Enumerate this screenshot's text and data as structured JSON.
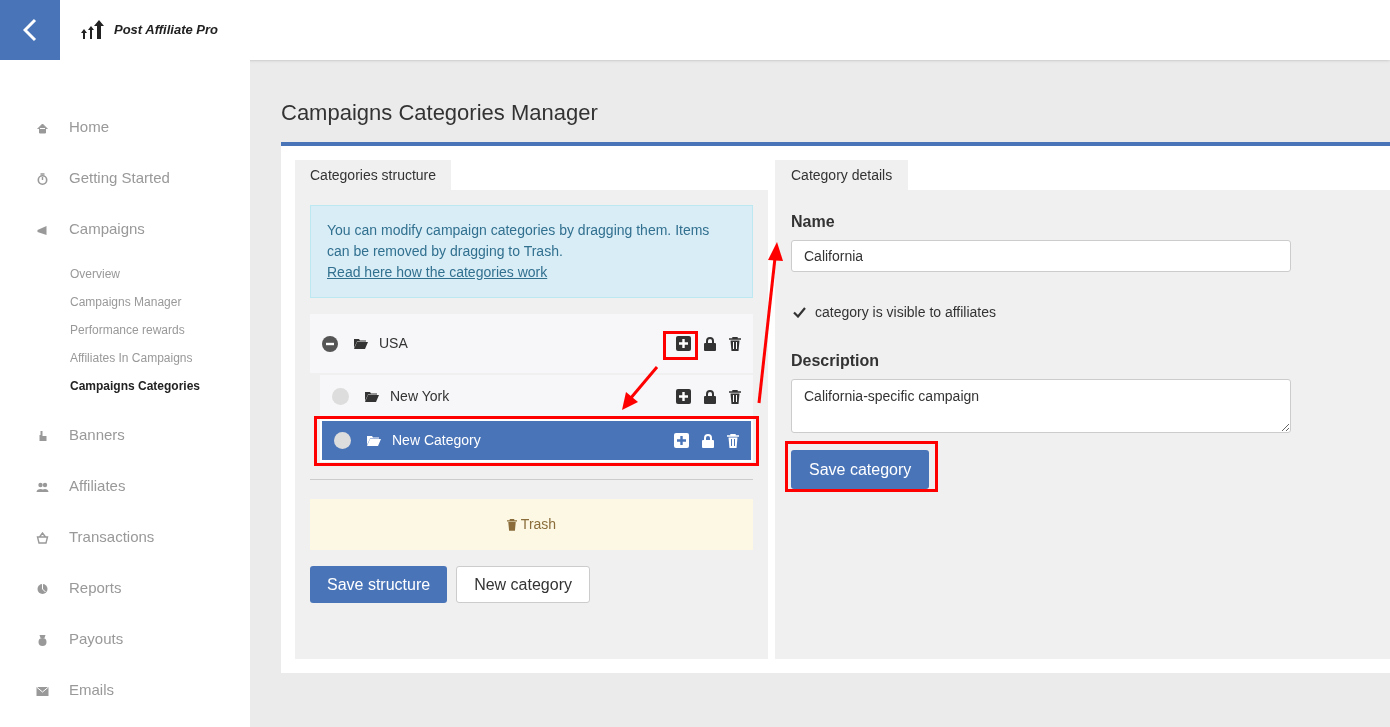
{
  "header": {
    "logo_text": "Post Affiliate Pro"
  },
  "sidebar": {
    "items": [
      {
        "label": "Home",
        "selected": false
      },
      {
        "label": "Getting Started",
        "selected": false
      },
      {
        "label": "Campaigns",
        "selected": false,
        "children": [
          {
            "label": "Overview",
            "selected": false
          },
          {
            "label": "Campaigns Manager",
            "selected": false
          },
          {
            "label": "Performance rewards",
            "selected": false
          },
          {
            "label": "Affiliates In Campaigns",
            "selected": false
          },
          {
            "label": "Campaigns Categories",
            "selected": true
          }
        ]
      },
      {
        "label": "Banners",
        "selected": false
      },
      {
        "label": "Affiliates",
        "selected": false
      },
      {
        "label": "Transactions",
        "selected": false
      },
      {
        "label": "Reports",
        "selected": false
      },
      {
        "label": "Payouts",
        "selected": false
      },
      {
        "label": "Emails",
        "selected": false
      }
    ]
  },
  "page_title": "Campaigns Categories Manager",
  "structure": {
    "tab": "Categories structure",
    "info": "You can modify campaign categories by dragging them. Items can be removed by dragging to Trash. ",
    "info_link": "Read here how the categories work",
    "tree": [
      {
        "label": "USA",
        "expanded": true,
        "selected": false,
        "children": [
          {
            "label": "New York",
            "selected": false
          },
          {
            "label": "New Category",
            "selected": true
          }
        ]
      }
    ],
    "trash": "Trash",
    "buttons": [
      {
        "label": "Save structure",
        "kind": "primary"
      },
      {
        "label": "New category",
        "kind": "secondary"
      }
    ]
  },
  "details": {
    "tab": "Category details",
    "name_label": "Name",
    "name_value": "California",
    "visible": {
      "label": "category is visible to affiliates",
      "checked": true
    },
    "description_label": "Description",
    "description_value": "California-specific campaign",
    "save": "Save category"
  }
}
